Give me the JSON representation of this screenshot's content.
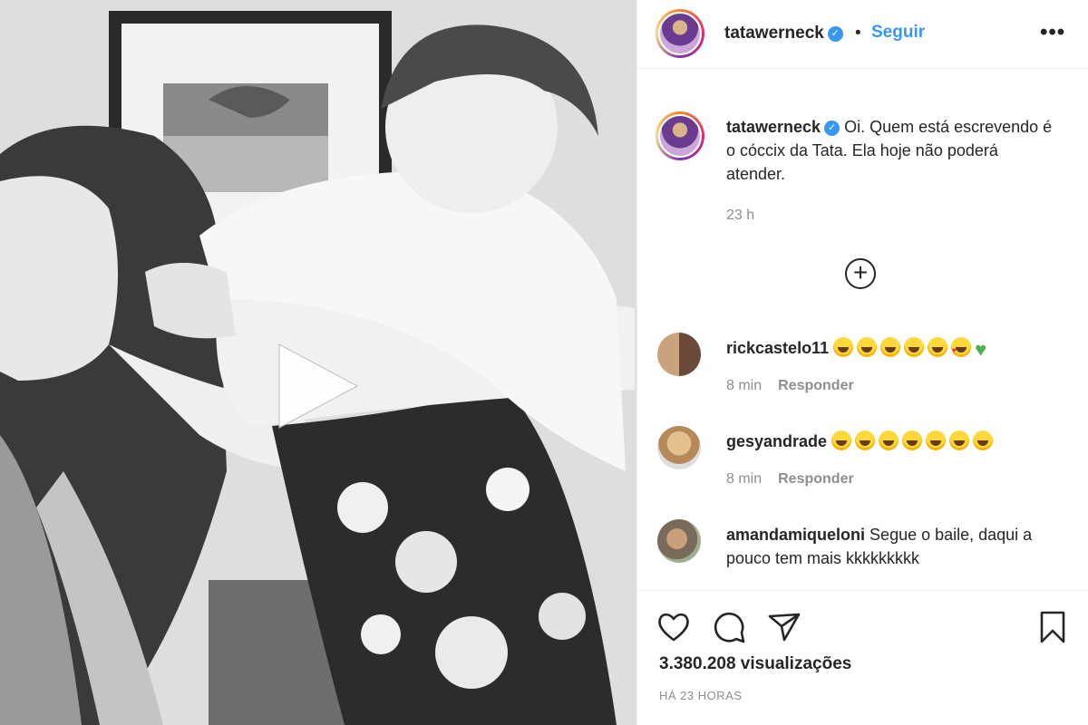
{
  "header": {
    "username": "tatawerneck",
    "separator": "•",
    "follow_label": "Seguir",
    "more_label": "•••"
  },
  "caption": {
    "username": "tatawerneck",
    "text": "Oi. Quem está escrevendo é o cóccix da Tata. Ela hoje não poderá atender.",
    "time": "23 h"
  },
  "load_more_icon": "plus-circle-icon",
  "comments": [
    {
      "username": "rickcastelo11",
      "text": "",
      "emojis": [
        "tears-of-joy",
        "tears-of-joy",
        "tears-of-joy",
        "tears-of-joy",
        "sweat-smile",
        "heart-eyes",
        "green-heart"
      ],
      "time": "8 min",
      "reply_label": "Responder"
    },
    {
      "username": "gesyandrade",
      "text": "",
      "emojis": [
        "tears-of-joy",
        "tears-of-joy",
        "tears-of-joy",
        "tears-of-joy",
        "tears-of-joy",
        "tears-of-joy",
        "tears-of-joy"
      ],
      "time": "8 min",
      "reply_label": "Responder"
    },
    {
      "username": "amandamiqueloni",
      "text": "Segue o baile, daqui a pouco tem mais kkkkkkkkk",
      "emojis": [],
      "time": "",
      "reply_label": ""
    }
  ],
  "actions": {
    "icons": [
      "heart-icon",
      "comment-icon",
      "share-icon",
      "bookmark-icon"
    ],
    "views": "3.380.208 visualizações",
    "time_ago": "HÁ 23 HORAS"
  },
  "colors": {
    "link_blue": "#3897f0",
    "text": "#262626",
    "muted": "#8e8e8e",
    "border": "#efefef"
  }
}
